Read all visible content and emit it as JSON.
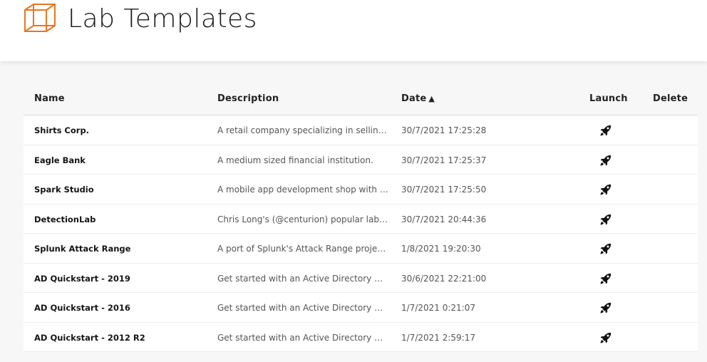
{
  "header": {
    "title": "Lab Templates",
    "logo_icon": "cube-outline-icon",
    "logo_color": "#e8761f"
  },
  "table": {
    "columns": {
      "name": "Name",
      "description": "Description",
      "date": "Date",
      "date_sort_indicator": "▲",
      "launch": "Launch",
      "delete": "Delete"
    },
    "launch_icon": "rocket-icon",
    "rows": [
      {
        "name": "Shirts Corp.",
        "description": "A retail company specializing in selling shir...",
        "date": "30/7/2021 17:25:28"
      },
      {
        "name": "Eagle Bank",
        "description": "A medium sized financial institution.",
        "date": "30/7/2021 17:25:37"
      },
      {
        "name": "Spark Studio",
        "description": "A mobile app development shop with a sm...",
        "date": "30/7/2021 17:25:50"
      },
      {
        "name": "DetectionLab",
        "description": "Chris Long's (@centurion) popular lab for c...",
        "date": "30/7/2021 20:44:36"
      },
      {
        "name": "Splunk Attack Range",
        "description": "A port of Splunk's Attack Range project to t...",
        "date": "1/8/2021 19:20:30"
      },
      {
        "name": "AD Quickstart - 2019",
        "description": "Get started with an Active Directory Domai...",
        "date": "30/6/2021 22:21:00"
      },
      {
        "name": "AD Quickstart - 2016",
        "description": "Get started with an Active Directory Domai...",
        "date": "1/7/2021 0:21:07"
      },
      {
        "name": "AD Quickstart - 2012 R2",
        "description": "Get started with an Active Directory Domai...",
        "date": "1/7/2021 2:59:17"
      }
    ]
  }
}
